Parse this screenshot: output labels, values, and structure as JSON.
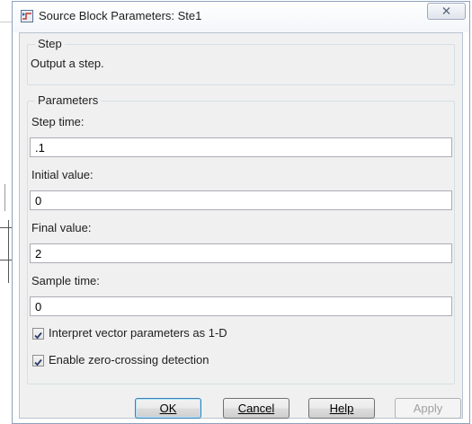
{
  "window": {
    "title": "Source Block Parameters: Ste1",
    "app_icon": "simulink-block-icon",
    "close_icon": "close-x-icon"
  },
  "description_group": {
    "legend": "Step",
    "text": "Output a step."
  },
  "parameters_group": {
    "legend": "Parameters",
    "fields": [
      {
        "label": "Step time:",
        "value": ".1"
      },
      {
        "label": "Initial value:",
        "value": "0"
      },
      {
        "label": "Final value:",
        "value": "2"
      },
      {
        "label": "Sample time:",
        "value": "0"
      }
    ],
    "checkboxes": [
      {
        "label": "Interpret vector parameters as 1-D",
        "checked": true
      },
      {
        "label": "Enable zero-crossing detection",
        "checked": true
      }
    ]
  },
  "buttons": {
    "ok": "OK",
    "cancel": "Cancel",
    "help": "Help",
    "apply": "Apply"
  },
  "colors": {
    "dialog_bg": "#f0f0f0",
    "default_button_border": "#3c7fb1",
    "disabled_text": "#a0a0a0"
  }
}
